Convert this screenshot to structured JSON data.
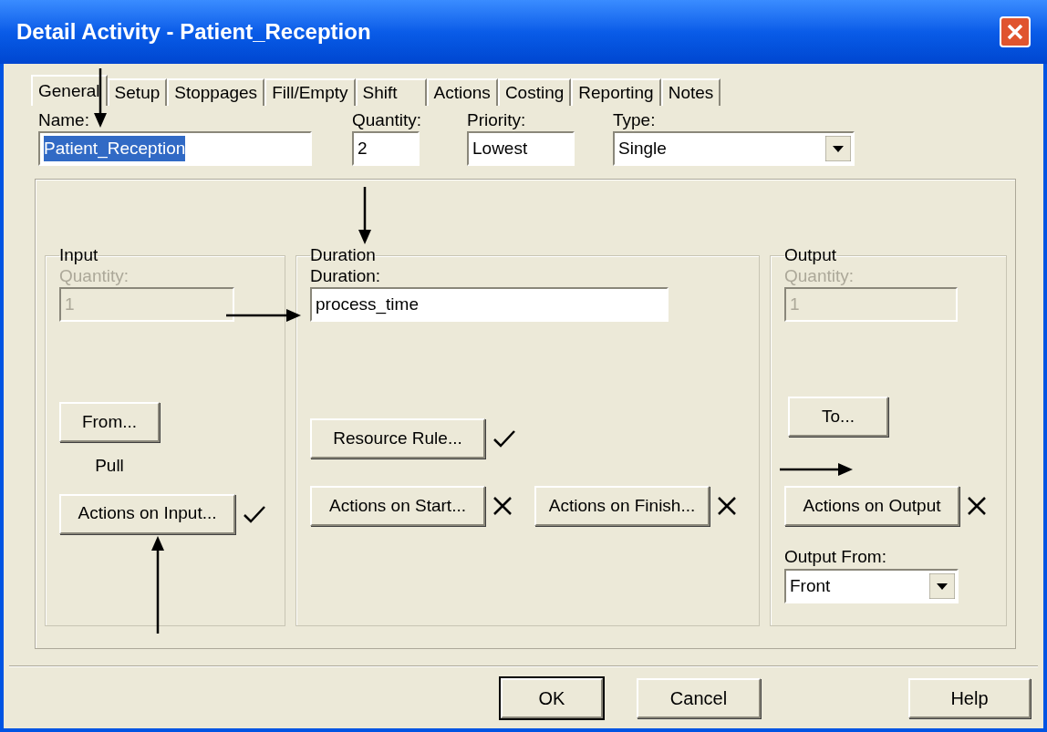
{
  "window": {
    "title": "Detail Activity - Patient_Reception"
  },
  "tabs": [
    {
      "label": "General",
      "selected": true
    },
    {
      "label": "Setup",
      "selected": false
    },
    {
      "label": "Stoppages",
      "selected": false
    },
    {
      "label": "Fill/Empty",
      "selected": false
    },
    {
      "label": "Shift",
      "selected": false
    },
    {
      "label": "Actions",
      "selected": false
    },
    {
      "label": "Costing",
      "selected": false
    },
    {
      "label": "Reporting",
      "selected": false
    },
    {
      "label": "Notes",
      "selected": false
    }
  ],
  "name": {
    "label": "Name:",
    "value": "Patient_Reception",
    "text_selected": true
  },
  "quantity": {
    "label": "Quantity:",
    "value": "2"
  },
  "priority": {
    "label": "Priority:",
    "value": "Lowest"
  },
  "type": {
    "label": "Type:",
    "value": "Single"
  },
  "input": {
    "title": "Input",
    "quantity": {
      "label": "Quantity:",
      "value": "1",
      "disabled": true
    },
    "from_button": "From...",
    "from_mode": "Pull",
    "actions_button": "Actions on Input...",
    "actions_defined": true
  },
  "duration": {
    "title": "Duration",
    "label": "Duration:",
    "value": "process_time",
    "resource_button": "Resource Rule...",
    "resource_defined": true,
    "start_button": "Actions on Start...",
    "start_defined": false,
    "finish_button": "Actions on Finish...",
    "finish_defined": false
  },
  "output": {
    "title": "Output",
    "quantity": {
      "label": "Quantity:",
      "value": "1",
      "disabled": true
    },
    "to_button": "To...",
    "actions_button": "Actions on Output",
    "actions_defined": false,
    "from_label": "Output From:",
    "from_value": "Front"
  },
  "buttons": [
    {
      "label": "OK",
      "default": true
    },
    {
      "label": "Cancel",
      "default": false
    },
    {
      "label": "Help",
      "default": false
    }
  ]
}
